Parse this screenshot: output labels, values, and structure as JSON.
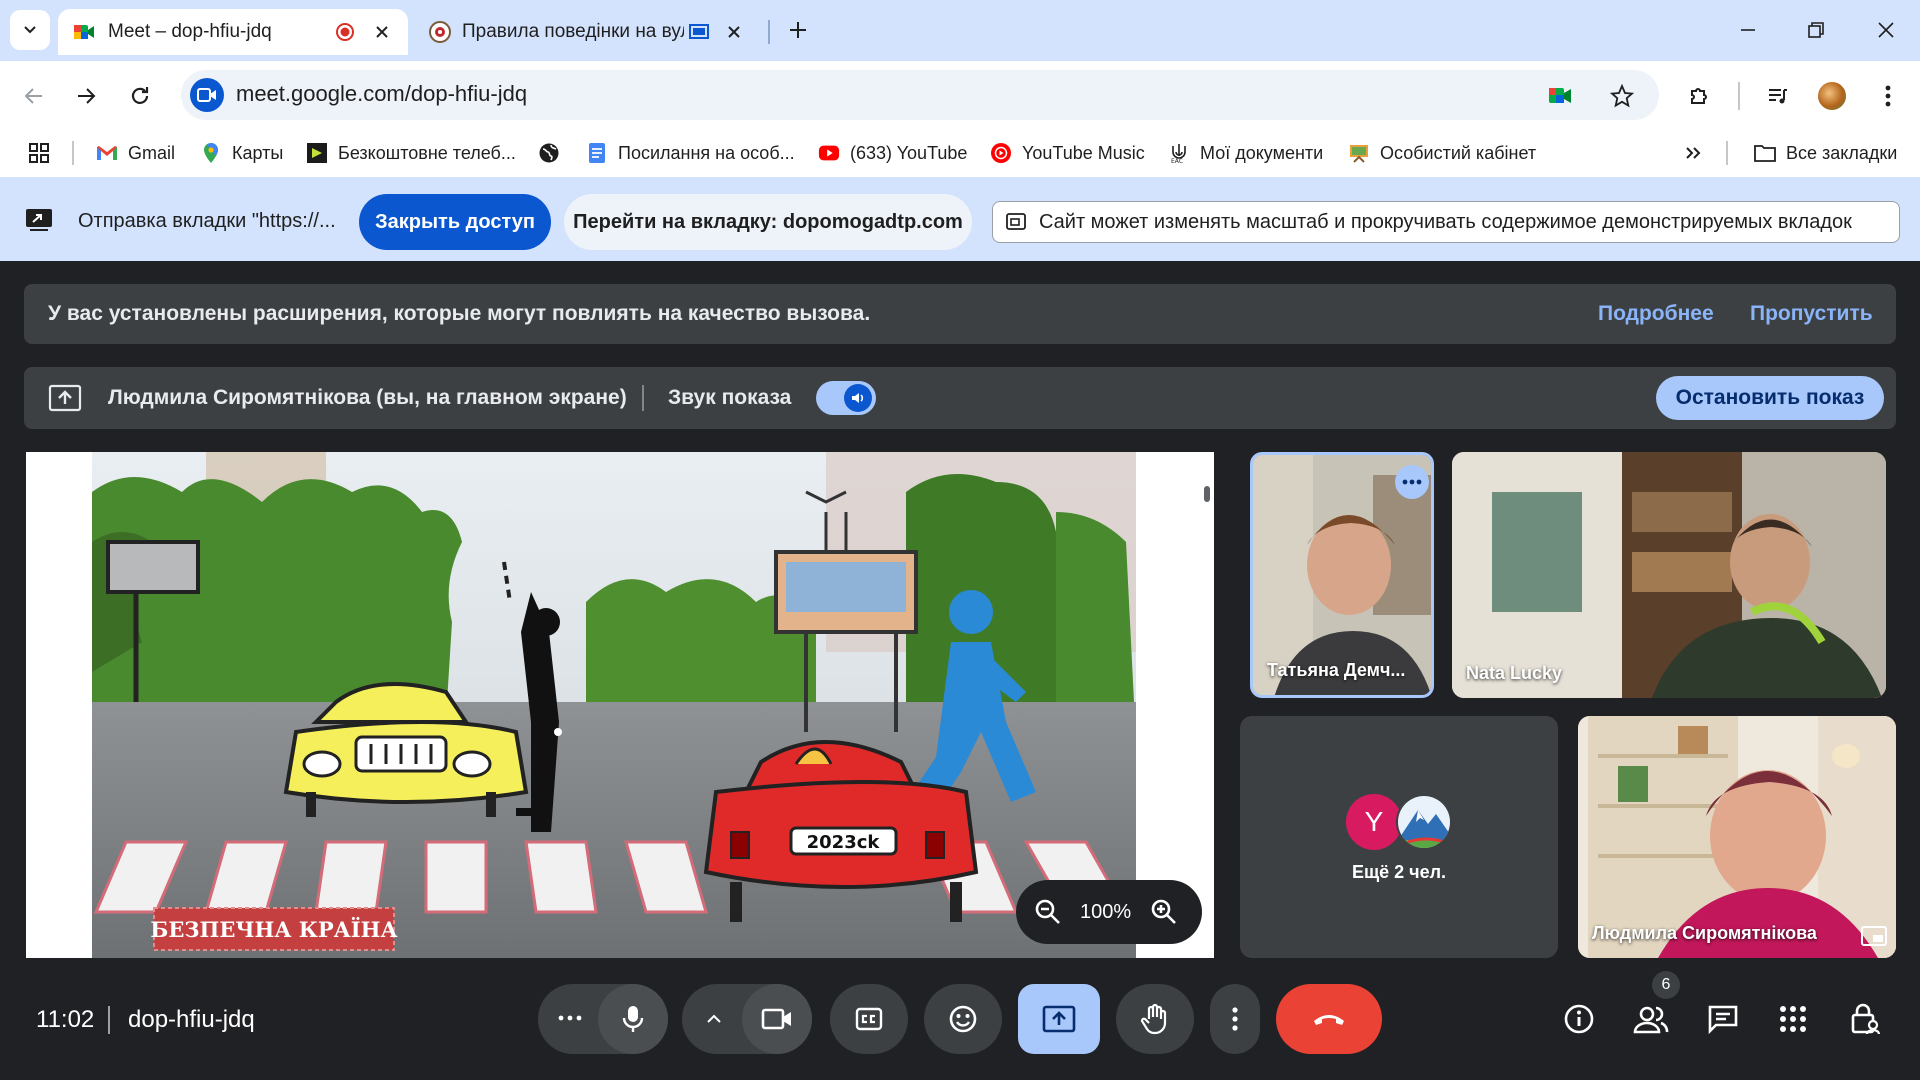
{
  "tabs": [
    {
      "title": "Meet – dop-hfiu-jdq",
      "recording": true
    },
    {
      "title": "Правила поведінки на вул"
    }
  ],
  "address_bar": {
    "url": "meet.google.com/dop-hfiu-jdq"
  },
  "bookmarks": [
    {
      "label": "Gmail"
    },
    {
      "label": "Карты"
    },
    {
      "label": "Безкоштовне телеб..."
    },
    {
      "label": ""
    },
    {
      "label": "Посилання на особ..."
    },
    {
      "label": "(633) YouTube"
    },
    {
      "label": "YouTube Music"
    },
    {
      "label": "Мої документи"
    },
    {
      "label": "Особистий кабінет"
    }
  ],
  "all_bookmarks_label": "Все закладки",
  "share_bar": {
    "sending_text": "Отправка вкладки \"https://...",
    "stop_access": "Закрыть доступ",
    "go_to_tab": "Перейти на вкладку: dopomogadtp.com",
    "site_permission": "Сайт может изменять масштаб и прокручивать содержимое демонстрируемых вкладок"
  },
  "warning": {
    "text": "У вас установлены расширения, которые могут повлиять на качество вызова.",
    "more": "Подробнее",
    "skip": "Пропустить"
  },
  "present_bar": {
    "presenter": "Людмила Сиромятнікова (вы, на главном экране)",
    "audio_label": "Звук показа",
    "audio_on": true,
    "stop_button": "Остановить показ"
  },
  "stage": {
    "caption": "БЕЗПЕЧНА КРАЇНА",
    "plate": "2023ck",
    "zoom": "100%"
  },
  "participants": [
    {
      "name": "Татьяна Демч..."
    },
    {
      "name": "Nata Lucky"
    },
    {
      "name": "Людмила Сиромятнікова"
    }
  ],
  "more_people": {
    "initial": "Y",
    "label": "Ещё 2 чел."
  },
  "bottom": {
    "time": "11:02",
    "meeting_code": "dop-hfiu-jdq",
    "people_count": "6"
  },
  "colors": {
    "tabstrip": "#d3e3fd",
    "meet_bg": "#202124",
    "accent": "#a8c7fa",
    "hangup": "#ea4335",
    "stop_pill": "#0b57d0"
  }
}
